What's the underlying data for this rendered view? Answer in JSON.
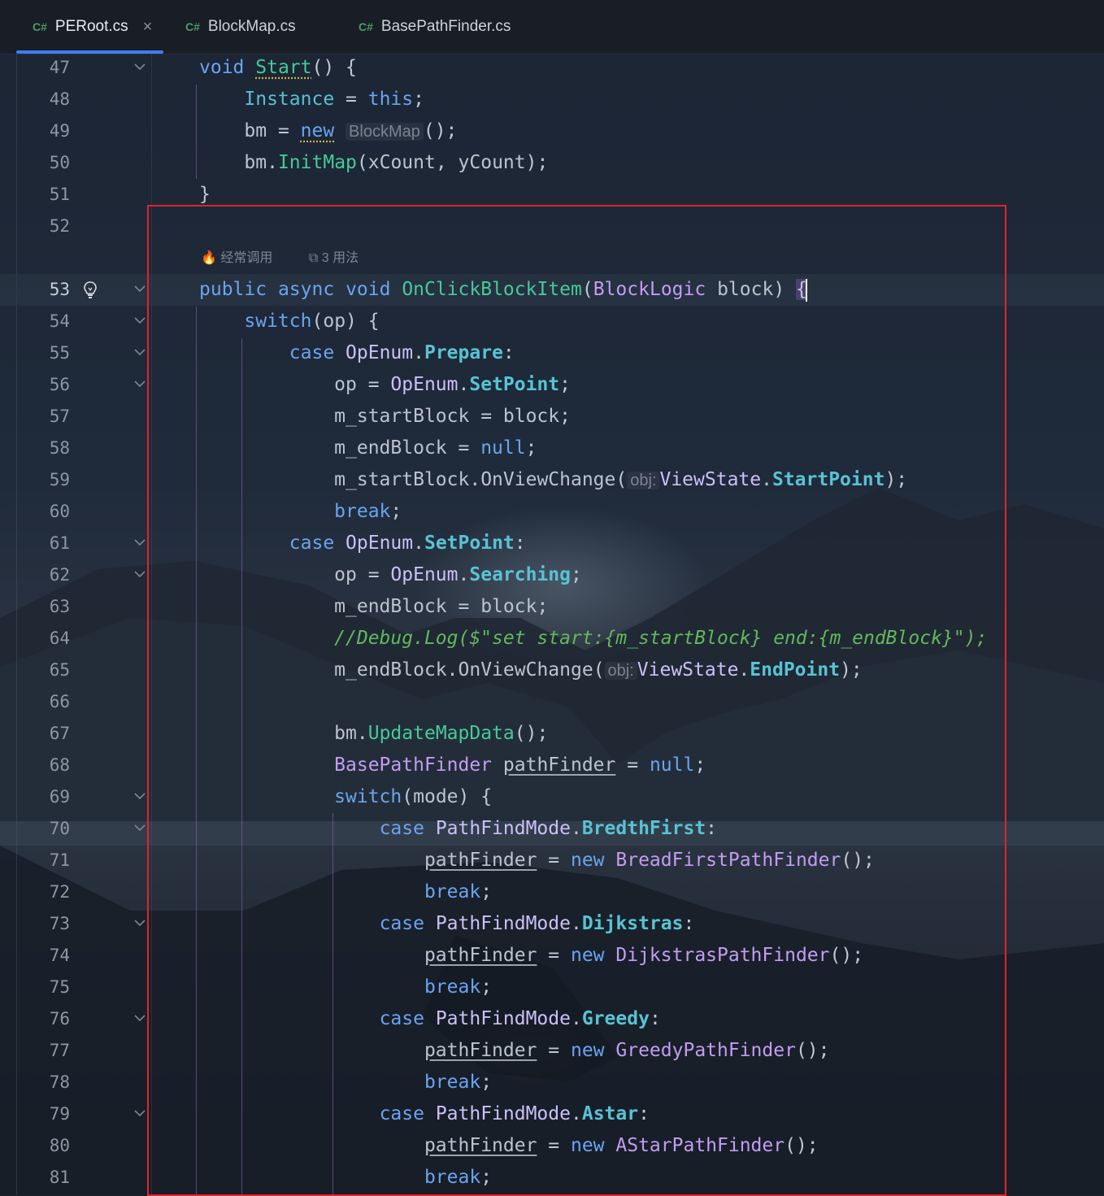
{
  "tabs": [
    {
      "lang": "C#",
      "label": "PERoot.cs",
      "active": true,
      "closable": true
    },
    {
      "lang": "C#",
      "label": "BlockMap.cs",
      "active": false
    },
    {
      "lang": "C#",
      "label": "BasePathFinder.cs",
      "active": false
    }
  ],
  "code_lens": {
    "usage": "经常调用",
    "refs": "3 用法"
  },
  "inlay_hints": {
    "type_hint": "BlockMap",
    "param_obj": "obj:"
  },
  "lines": [
    {
      "n": "47",
      "fold": true
    },
    {
      "n": "48"
    },
    {
      "n": "49"
    },
    {
      "n": "50"
    },
    {
      "n": "51"
    },
    {
      "n": "52"
    },
    {
      "n": "53",
      "fold": true,
      "current": true
    },
    {
      "n": "54",
      "fold": true
    },
    {
      "n": "55",
      "fold": true
    },
    {
      "n": "56",
      "fold": true
    },
    {
      "n": "57"
    },
    {
      "n": "58"
    },
    {
      "n": "59"
    },
    {
      "n": "60"
    },
    {
      "n": "61",
      "fold": true
    },
    {
      "n": "62",
      "fold": true
    },
    {
      "n": "63"
    },
    {
      "n": "64"
    },
    {
      "n": "65"
    },
    {
      "n": "66"
    },
    {
      "n": "67"
    },
    {
      "n": "68"
    },
    {
      "n": "69",
      "fold": true
    },
    {
      "n": "70",
      "fold": true
    },
    {
      "n": "71"
    },
    {
      "n": "72"
    },
    {
      "n": "73",
      "fold": true
    },
    {
      "n": "74"
    },
    {
      "n": "75"
    },
    {
      "n": "76",
      "fold": true
    },
    {
      "n": "77"
    },
    {
      "n": "78"
    },
    {
      "n": "79",
      "fold": true
    },
    {
      "n": "80"
    },
    {
      "n": "81"
    }
  ],
  "tokens": {
    "kw_void": "void",
    "kw_public": "public",
    "kw_async": "async",
    "kw_this": "this",
    "kw_new": "new",
    "kw_switch": "switch",
    "kw_case": "case",
    "kw_break": "break",
    "kw_null": "null",
    "m_Start": "Start",
    "m_InitMap": "InitMap",
    "m_OnClickBlockItem": "OnClickBlockItem",
    "m_OnViewChange": "OnViewChange",
    "m_UpdateMapData": "UpdateMapData",
    "f_Instance": "Instance",
    "v_bm": "bm",
    "v_xCount": "xCount",
    "v_yCount": "yCount",
    "t_BlockLogic": "BlockLogic",
    "v_block": "block",
    "v_op": "op",
    "v_mode": "mode",
    "t_OpEnum": "OpEnum",
    "e_Prepare": "Prepare",
    "e_SetPoint": "SetPoint",
    "e_Searching": "Searching",
    "f_startBlock": "m_startBlock",
    "f_endBlock": "m_endBlock",
    "t_ViewState": "ViewState",
    "e_StartPoint": "StartPoint",
    "e_EndPoint": "EndPoint",
    "comment64": "//Debug.Log($\"set start:{m_startBlock} end:{m_endBlock}\");",
    "t_BasePathFinder": "BasePathFinder",
    "v_pathFinder": "pathFinder",
    "t_PathFindMode": "PathFindMode",
    "e_BredthFirst": "BredthFirst",
    "e_Dijkstras": "Dijkstras",
    "e_Greedy": "Greedy",
    "e_Astar": "Astar",
    "t_BreadFirst": "BreadFirstPathFinder",
    "t_Dijkstras": "DijkstrasPathFinder",
    "t_Greedy": "GreedyPathFinder",
    "t_AStar": "AStarPathFinder"
  },
  "colors": {
    "accent_tab": "#3d7ef0",
    "highlight_box": "#e0242b"
  }
}
